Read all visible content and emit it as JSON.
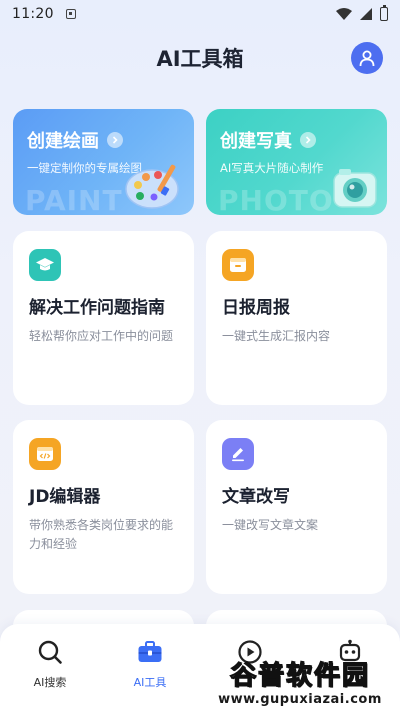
{
  "status_bar": {
    "time": "11:20"
  },
  "header": {
    "title": "AI工具箱"
  },
  "features": [
    {
      "title": "创建绘画",
      "subtitle": "一键定制你的专属绘图",
      "watermark": "PAINT"
    },
    {
      "title": "创建写真",
      "subtitle": "AI写真大片随心制作",
      "watermark": "PHOTO"
    }
  ],
  "tools": [
    {
      "title": "解决工作问题指南",
      "desc": "轻松帮你应对工作中的问题",
      "icon": "graduation-cap-icon",
      "color": "#2ec4b6"
    },
    {
      "title": "日报周报",
      "desc": "一键式生成汇报内容",
      "icon": "calendar-report-icon",
      "color": "#f5a524"
    },
    {
      "title": "JD编辑器",
      "desc": "带你熟悉各类岗位要求的能力和经验",
      "icon": "code-window-icon",
      "color": "#f5a524"
    },
    {
      "title": "文章改写",
      "desc": "一键改写文章文案",
      "icon": "pencil-icon",
      "color": "#7b7ff5"
    }
  ],
  "nav": {
    "items": [
      {
        "label": "AI搜索",
        "icon": "search-icon"
      },
      {
        "label": "AI工具",
        "icon": "toolbox-icon",
        "active": true
      },
      {
        "label": "",
        "icon": "play-circle-icon"
      },
      {
        "label": "",
        "icon": "robot-icon"
      }
    ]
  },
  "watermark": {
    "main": "谷普软件园",
    "url": "www.gupuxiazai.com"
  },
  "colors": {
    "accent": "#3b6ef5",
    "avatar": "#4d6ef0"
  }
}
